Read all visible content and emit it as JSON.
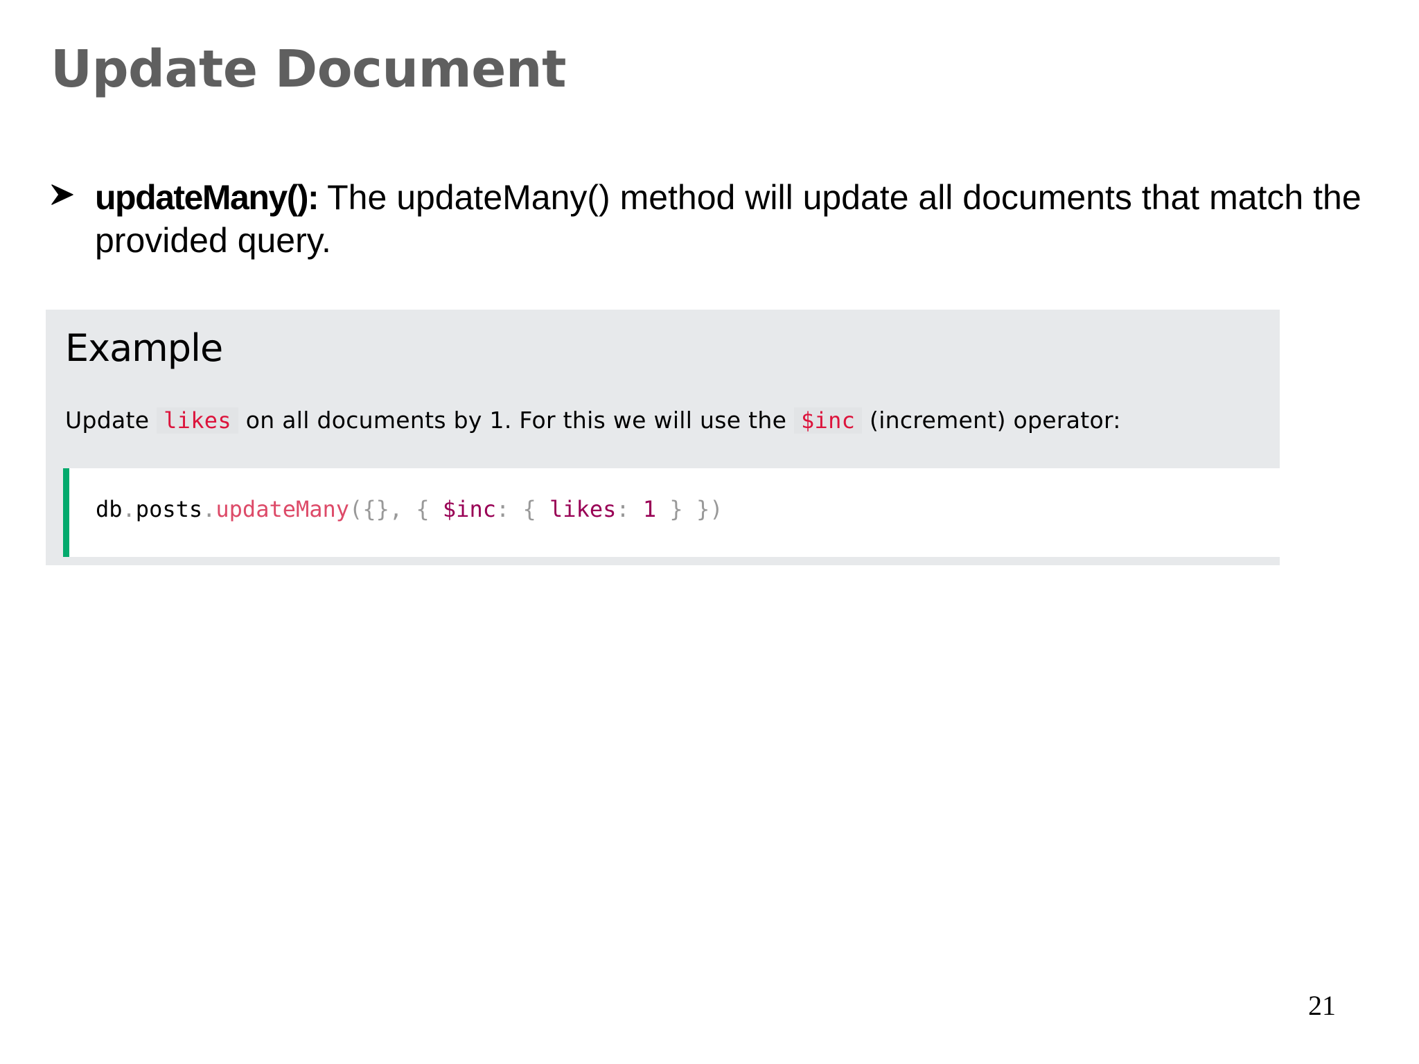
{
  "title": "Update Document",
  "bullet": {
    "term": "updateMany():",
    "text": " The updateMany() method will update all documents that match the provided query."
  },
  "example": {
    "heading": "Example",
    "desc_before": "Update ",
    "desc_code1": "likes",
    "desc_middle": " on all documents by 1. For this we will use the ",
    "desc_code2": "$inc",
    "desc_after": " (increment) operator:",
    "code": {
      "t1": "db",
      "t2": ".",
      "t3": "posts",
      "t4": ".",
      "t5": "updateMany",
      "t6": "({}, { ",
      "t7": "$inc",
      "t8": ": { ",
      "t9": "likes",
      "t10": ": ",
      "t11": "1",
      "t12": " } })"
    }
  },
  "page_number": "21"
}
